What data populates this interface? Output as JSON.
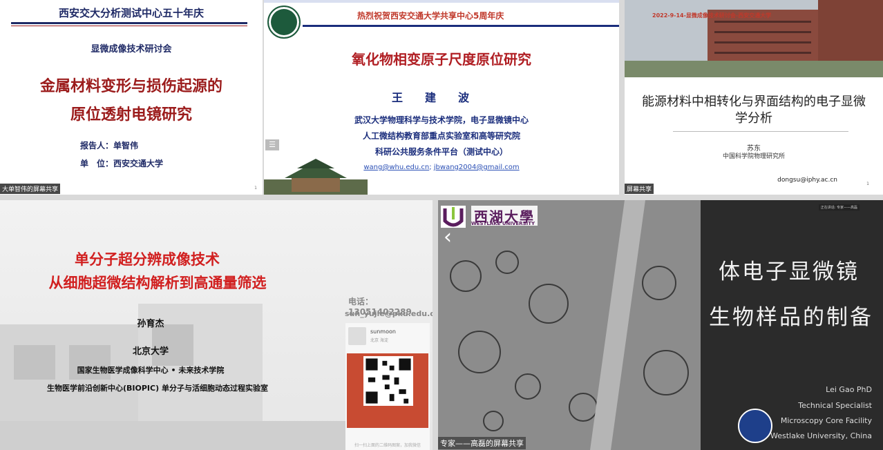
{
  "p1": {
    "header": "西安交大分析测试中心五十年庆",
    "subtitle": "显微成像技术研讨会",
    "title_line1": "金属材料变形与损伤起源的",
    "title_line2": "原位透射电镜研究",
    "reporter": "报告人：单智伟",
    "unit": "单　位：西安交通大学",
    "share_label": "大单智伟的屏幕共享",
    "page": "1"
  },
  "p2": {
    "header": "热烈祝贺西安交通大学共享中心5周年庆",
    "title": "氧化物相变原子尺度原位研究",
    "author": "王建波",
    "affil1": "武汉大学物理科学与技术学院，电子显微镜中心",
    "affil2": "人工微结构教育部重点实验室和高等研究院",
    "affil3": "科研公共服务条件平台（测试中心）",
    "email1": "wang@whu.edu.cn",
    "email_sep": "; ",
    "email2": "jbwang2004@gmail.com",
    "menu_glyph": "☰"
  },
  "p3": {
    "header": "2022-9-14-显微成像技术研讨会-西安交通大学",
    "title": "能源材料中相转化与界面结构的电子显微学分析",
    "name": "苏东",
    "institute": "中国科学院物理研究所",
    "email": "dongsu@iphy.ac.cn",
    "page": "1",
    "share_label": "屏幕共享"
  },
  "p4": {
    "title_line1": "单分子超分辨成像技术",
    "title_line2": "从细胞超微结构解析到高通量筛选",
    "speaker": "孙育杰",
    "university": "北京大学",
    "line1": "国家生物医学成像科学中心 • 未来技术学院",
    "line2": "生物医学前沿创新中心(BIOPIC) 单分子与活细胞动态过程实验室",
    "phone": "电话：13051402289",
    "email": "sun_yujie@pku.edu.cn",
    "wechat_name": "sunmoon",
    "wechat_loc": "北京 海淀",
    "qr_caption": "扫一扫上面的二维码图案，加我微信"
  },
  "p5": {
    "uni_cn": "西湖大學",
    "uni_en": "WESTLAKE UNIVERSITY",
    "title_line1": "体电子显微镜",
    "title_line2": "生物样品的制备",
    "presenter": "Lei Gao PhD",
    "role": "Technical Specialist",
    "facility": "Microscopy Core Facility",
    "university": "Westlake University, China",
    "share_label": "专家——高磊的屏幕共享",
    "mini_label": "正在讲话: 专家——高磊"
  },
  "colors": {
    "navy": "#1f2a66",
    "crimson": "#9b1b1b",
    "red": "#d11f1f",
    "westlake_purple": "#5a1d5e"
  }
}
